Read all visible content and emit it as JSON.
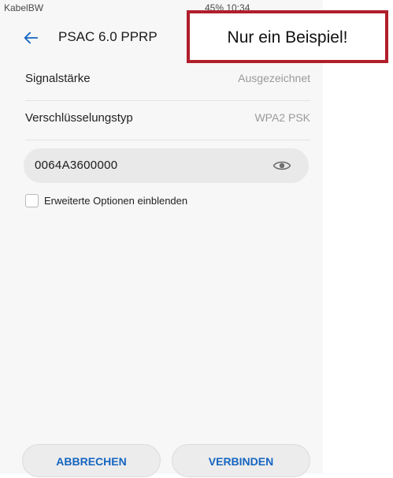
{
  "status_bar": {
    "carrier": "KabelBW",
    "right_text": "45% 10:34"
  },
  "toolbar": {
    "title": "PSAC 6.0 PPRP",
    "back_icon": "arrow-left-icon"
  },
  "details": {
    "signal_label": "Signalstärke",
    "signal_value": "Ausgezeichnet",
    "encryption_label": "Verschlüsselungstyp",
    "encryption_value": "WPA2 PSK"
  },
  "password": {
    "value": "0064A3600000",
    "toggle_icon": "eye-icon"
  },
  "advanced": {
    "label": "Erweiterte Optionen einblenden",
    "checked": false
  },
  "buttons": {
    "cancel": "ABBRECHEN",
    "connect": "VERBINDEN"
  },
  "annotation": {
    "text": "Nur ein Beispiel!"
  },
  "colors": {
    "accent": "#1565c0",
    "annotation_border": "#b01e2a"
  }
}
